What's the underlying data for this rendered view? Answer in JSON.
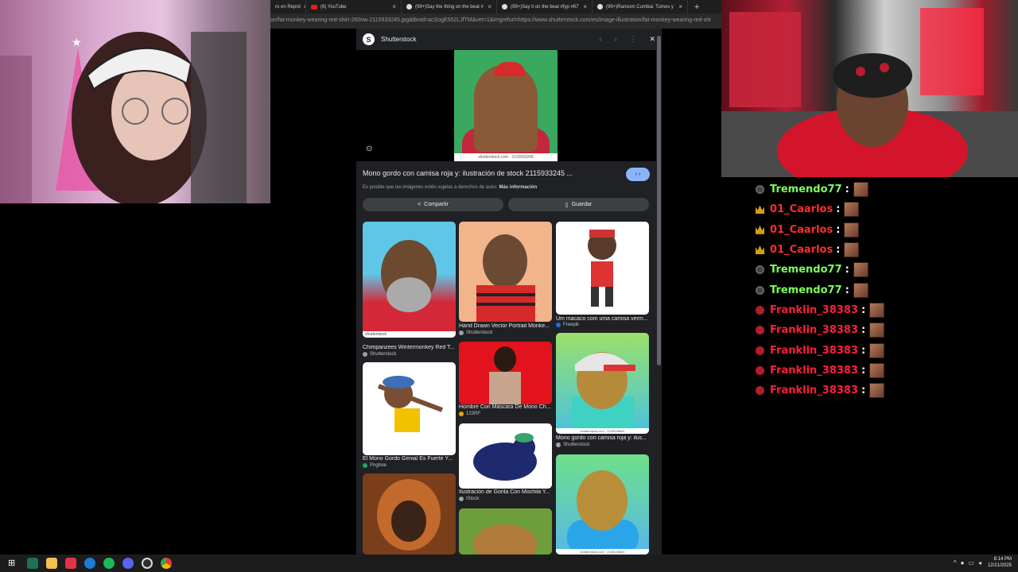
{
  "browser": {
    "tabs": [
      {
        "label": "ro en Reprd",
        "icon": "page-icon"
      },
      {
        "label": "(6) YouTube",
        "icon": "youtube-icon"
      },
      {
        "label": "(99+)Say the thing on the beat #",
        "icon": "tiktok-icon"
      },
      {
        "label": "(99+)Say it on the beat #fyp #67",
        "icon": "tiktok-icon"
      },
      {
        "label": "(99+)Ransom Cumbia: Tumos y",
        "icon": "tiktok-icon"
      }
    ],
    "new_tab": "+",
    "url": "on/fat-monkey-wearing-red-shirt-260nw-2115933245.jpg&tbnid=acSogE552LJfTM&vet=1&imgrefurl=https://www.shutterstock.com/es/image-illustration/fat-monkey-wearing-red-shi"
  },
  "panel": {
    "source": "Shutterstock",
    "main_watermark": "shutterstock.com · 2115933245",
    "title": "Mono gordo con camisa roja y: ilustración de stock 2115933245 ...",
    "visit_label": "‹ ›",
    "rights_text": "Es posible que las imágenes estén sujetas a derechos de autor.",
    "more_info": "Más información",
    "share_label": "Compartir",
    "save_label": "Guardar",
    "results": [
      {
        "caption": "Chimpanzees Wintermonkey Red T...",
        "source": "Shutterstock"
      },
      {
        "caption": "Hand Drawn Vector Portrait Monke...",
        "source": "Shutterstock"
      },
      {
        "caption": "Um macaco com uma camisa verm...",
        "source": "Freepik"
      },
      {
        "caption": "Hombre Con Máscara De Mono Ch...",
        "source": "123RF"
      },
      {
        "caption": "El Mono Gordo Genial Es Fuerte Y...",
        "source": "Pngtree"
      },
      {
        "caption": "Mono gordo con camisa roja y: ilus...",
        "source": "Shutterstock"
      },
      {
        "caption": "Ilustración de Gorila Con Mochila Y...",
        "source": "iStock"
      }
    ],
    "thumb_watermarks": [
      "shutterstock",
      "shutterstock.com · 2108138604",
      "shutterstock.com · 2108138624"
    ]
  },
  "chat": [
    {
      "badge": "mod",
      "user": "Tremendo77",
      "color": "#7dff5a"
    },
    {
      "badge": "vip",
      "user": "01_Caarlos",
      "color": "#ff2d2d"
    },
    {
      "badge": "vip",
      "user": "01_Caarlos",
      "color": "#ff2d2d"
    },
    {
      "badge": "vip",
      "user": "01_Caarlos",
      "color": "#ff2d2d"
    },
    {
      "badge": "mod",
      "user": "Tremendo77",
      "color": "#7dff5a"
    },
    {
      "badge": "mod",
      "user": "Tremendo77",
      "color": "#7dff5a"
    },
    {
      "badge": "red",
      "user": "Franklin_38383",
      "color": "#ff1e3c"
    },
    {
      "badge": "red",
      "user": "Franklin_38383",
      "color": "#ff1e3c"
    },
    {
      "badge": "red",
      "user": "Franklin_38383",
      "color": "#ff1e3c"
    },
    {
      "badge": "red",
      "user": "Franklin_38383",
      "color": "#ff1e3c"
    },
    {
      "badge": "red",
      "user": "Franklin_38383",
      "color": "#ff1e3c"
    }
  ],
  "chat_separator": ":",
  "taskbar": {
    "time": "8:14 PM",
    "date": "12/21/2025",
    "apps": [
      "start-icon",
      "terminal-icon",
      "file-explorer-icon",
      "vivaldi-icon",
      "edge-icon",
      "spotify-icon",
      "discord-icon",
      "obs-icon",
      "chrome-icon"
    ]
  }
}
